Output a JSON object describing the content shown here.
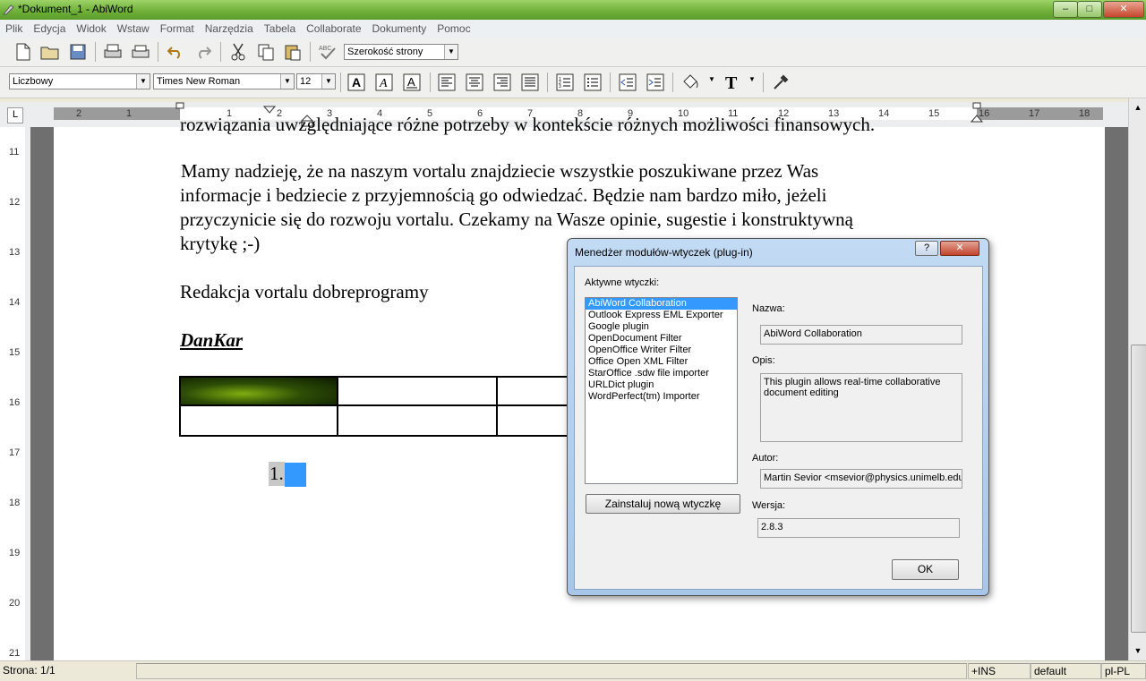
{
  "window": {
    "title": "*Dokument_1 - AbiWord",
    "buttons": {
      "minimize": "–",
      "maximize": "□",
      "close": "✕"
    }
  },
  "menubar": [
    "Plik",
    "Edycja",
    "Widok",
    "Wstaw",
    "Format",
    "Narzędzia",
    "Tabela",
    "Collaborate",
    "Dokumenty",
    "Pomoc"
  ],
  "toolbar1": {
    "zoom": "Szerokość strony"
  },
  "toolbar2": {
    "style": "Liczbowy",
    "font": "Times New Roman",
    "size": "12"
  },
  "ruler": {
    "h_ticks": [
      "2",
      "1",
      "1",
      "2",
      "3",
      "4",
      "5",
      "6",
      "7",
      "8",
      "9",
      "10",
      "11",
      "12",
      "13",
      "14",
      "15",
      "16",
      "17",
      "18"
    ],
    "v_ticks": [
      "11",
      "12",
      "13",
      "14",
      "15",
      "16",
      "17",
      "18",
      "19",
      "20",
      "21"
    ]
  },
  "document": {
    "cut_line": "rozwiązania uwzględniające różne potrzeby w kontekście różnych możliwości finansowych.",
    "paragraph_lines": [
      "Mamy nadzieję, że na naszym vortalu znajdziecie wszystkie poszukiwane przez Was",
      "informacje i bedziecie z przyjemnością go odwiedzać. Będzie nam bardzo miło, jeżeli",
      "przyczynicie się do rozwoju vortalu. Czekamy na Wasze opinie, sugestie i konstruktywną",
      "krytykę ;-)"
    ],
    "signature": "Redakcja vortalu dobreprogramy",
    "author": "DanKar",
    "list_number": "1."
  },
  "dialog": {
    "title": "Menedżer modułów-wtyczek (plug-in)",
    "help_button": "?",
    "close_button": "✕",
    "active_label": "Aktywne wtyczki:",
    "plugins": [
      "AbiWord Collaboration",
      "Outlook Express EML Exporter",
      "Google plugin",
      "OpenDocument Filter",
      "OpenOffice Writer Filter",
      "Office Open XML Filter",
      "StarOffice .sdw file importer",
      "URLDict plugin",
      "WordPerfect(tm) Importer"
    ],
    "selected_index": 0,
    "install_button": "Zainstaluj nową wtyczkę",
    "name_label": "Nazwa:",
    "name_value": "AbiWord Collaboration",
    "desc_label": "Opis:",
    "desc_value": "This plugin allows real-time collaborative document editing",
    "author_label": "Autor:",
    "author_value": "Martin Sevior <msevior@physics.unimelb.edu.a",
    "version_label": "Wersja:",
    "version_value": "2.8.3",
    "ok_button": "OK"
  },
  "statusbar": {
    "page": "Strona: 1/1",
    "mode": "+INS",
    "style": "default",
    "lang": "pl-PL"
  },
  "colors": {
    "selection": "#3399ff",
    "titlebar": "#7ab948",
    "page_bg": "#6f6f6f"
  }
}
